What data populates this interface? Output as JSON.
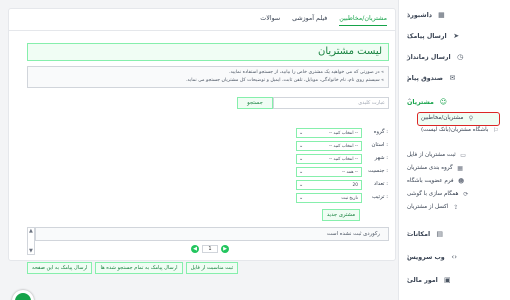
{
  "sidebar": {
    "items": [
      {
        "label": "داشبورد",
        "icon": "dashboard-icon",
        "glyph": "▦"
      },
      {
        "label": "ارسال پیامک",
        "icon": "send-icon",
        "glyph": "➤"
      },
      {
        "label": "ارسال زمانداز",
        "icon": "clock-icon",
        "glyph": "◷"
      },
      {
        "label": "صندوق پیام",
        "icon": "inbox-icon",
        "glyph": "✉"
      },
      {
        "label": "مشتریان",
        "icon": "users-icon",
        "glyph": "☺"
      },
      {
        "label": "امکانات",
        "icon": "features-icon",
        "glyph": "▤"
      },
      {
        "label": "وب سرویس",
        "icon": "code-icon",
        "glyph": "‹›"
      },
      {
        "label": "امور مالی",
        "icon": "finance-icon",
        "glyph": "▣"
      }
    ],
    "sub_items": [
      {
        "label": "مشتریان/مخاطبین",
        "icon": "contacts-icon",
        "glyph": "⚲"
      },
      {
        "label": "باشگاه مشتریان(بانک لیست)",
        "icon": "club-icon",
        "glyph": "⚐"
      },
      {
        "label": "ثبت مشتریان از فایل",
        "icon": "file-icon",
        "glyph": "▭"
      },
      {
        "label": "گروه بندی مشتریان",
        "icon": "group-icon",
        "glyph": "▦"
      },
      {
        "label": "فرم عضویت باشگاه",
        "icon": "form-icon",
        "glyph": "☻"
      },
      {
        "label": "همگام سازی با گوشی",
        "icon": "sync-icon",
        "glyph": "⟳"
      },
      {
        "label": "اکسل از مشتریان",
        "icon": "excel-icon",
        "glyph": "⇪"
      }
    ]
  },
  "tabs": [
    "مشتریان/مخاطبین",
    "فیلم آموزشی",
    "سوالات"
  ],
  "page_title": "لیست مشتریان",
  "notes": [
    "در صورتی که می خواهید یک مشتری خاص را بیابید، از جستجو استفاده نمایید.",
    "سیستم روی نام، نام خانوادگی، موبایل، تلفن ثابت، ایمیل و توضیحات کل مشتریان جستجو می نماید."
  ],
  "search": {
    "placeholder": "عبارت کلیدی",
    "button": "جستجو"
  },
  "filters": [
    {
      "label": "گروه :",
      "value": "-- انتخاب کنید --"
    },
    {
      "label": "استان :",
      "value": "-- انتخاب کنید --"
    },
    {
      "label": "شهر :",
      "value": "-- انتخاب کنید --"
    },
    {
      "label": "جنسیت :",
      "value": "-- همه --"
    },
    {
      "label": "تعداد :",
      "value": "20"
    },
    {
      "label": "ترتیب :",
      "value": "تاریخ ثبت"
    }
  ],
  "new_customer": "مشتری جدید",
  "records_text": "رکوردی ثبت نشده است",
  "pager": {
    "page": "1"
  },
  "actions": [
    "ارسال پیامک به این صفحه",
    "ارسال پیامک به تمام جستجو شده ها",
    "ثبت مناسبت از فایل"
  ]
}
